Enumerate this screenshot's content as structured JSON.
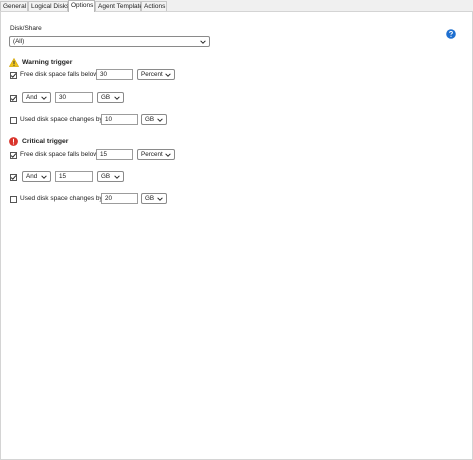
{
  "tabs": [
    {
      "label": "General"
    },
    {
      "label": "Logical Disks"
    },
    {
      "label": "Options"
    },
    {
      "label": "Agent Template"
    },
    {
      "label": "Actions"
    }
  ],
  "disk_share": {
    "label": "Disk/Share",
    "value": "(All)"
  },
  "warning": {
    "title": "Warning trigger",
    "free_space_label": "Free disk space falls below",
    "free_space_checked": true,
    "free_space_value": "30",
    "free_space_unit": "Percent",
    "and_checked": true,
    "and_operator": "And",
    "and_value": "30",
    "and_unit": "GB",
    "used_changes_label": "Used disk space changes by",
    "used_changes_checked": false,
    "used_changes_value": "10",
    "used_changes_unit": "GB"
  },
  "critical": {
    "title": "Critical trigger",
    "free_space_label": "Free disk space falls below",
    "free_space_checked": true,
    "free_space_value": "15",
    "free_space_unit": "Percent",
    "and_checked": true,
    "and_operator": "And",
    "and_value": "15",
    "and_unit": "GB",
    "used_changes_label": "Used disk space changes by",
    "used_changes_checked": false,
    "used_changes_value": "20",
    "used_changes_unit": "GB"
  },
  "colors": {
    "warning_icon": "#f0c419",
    "critical_icon": "#d9342b",
    "help_icon": "#1e6fd0"
  },
  "icons": {
    "help": "question-circle-icon",
    "warning": "warning-triangle-icon",
    "critical": "exclamation-circle-icon",
    "chevron": "chevron-down-icon",
    "check": "check-icon"
  }
}
